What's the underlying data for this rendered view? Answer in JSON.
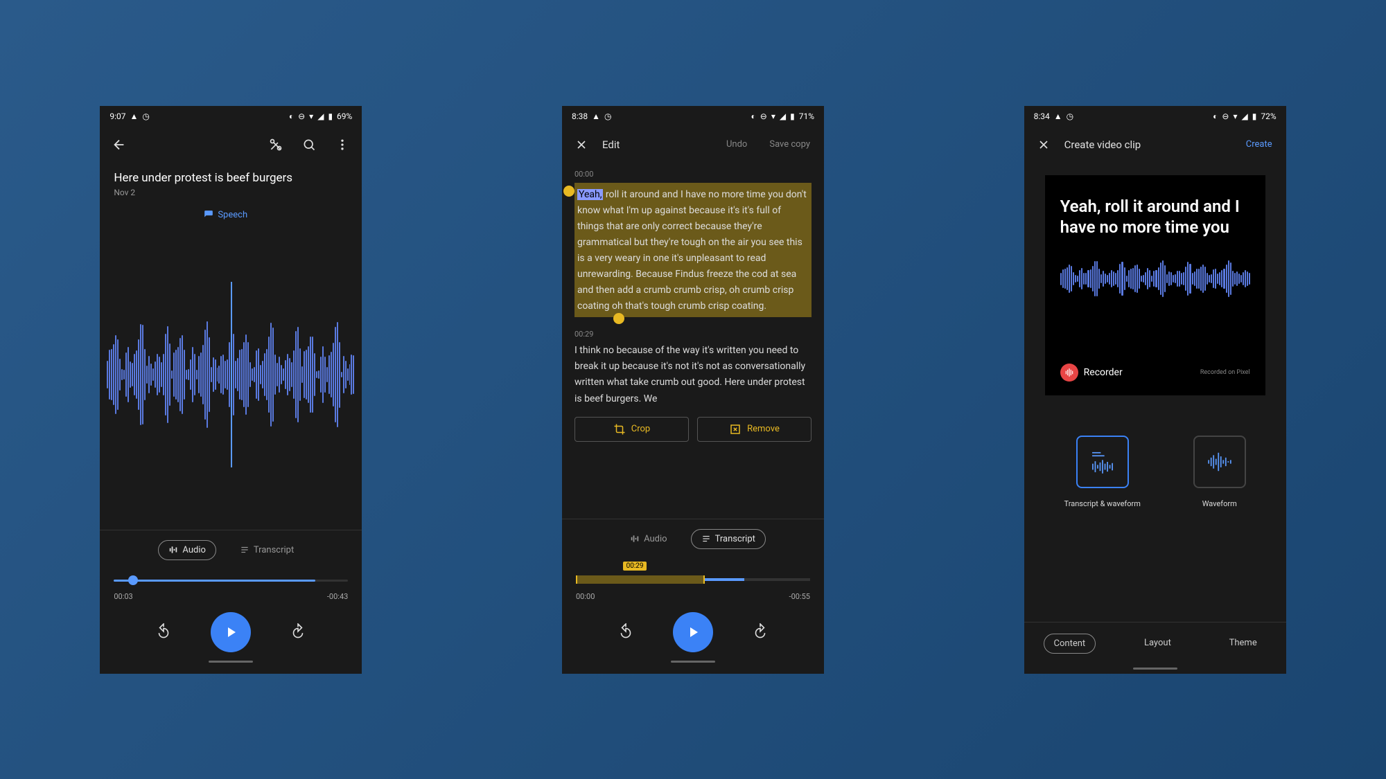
{
  "screen1": {
    "status": {
      "time": "9:07",
      "battery": "69%"
    },
    "title": "Here under protest is beef burgers",
    "date": "Nov 2",
    "speech_label": "Speech",
    "tabs": {
      "audio": "Audio",
      "transcript": "Transcript"
    },
    "time_current": "00:03",
    "time_remaining": "-00:43",
    "progress_percent": 7
  },
  "screen2": {
    "status": {
      "time": "8:38",
      "battery": "71%"
    },
    "title": "Edit",
    "undo": "Undo",
    "save": "Save copy",
    "ts1_time": "00:00",
    "ts1_word": "Yeah,",
    "ts1_text": " roll it around and I have no more time you don't know what I'm up against because it's it's full of things that are only correct because they're grammatical but they're tough on the air you see this is a very weary in one it's unpleasant to read unrewarding. Because Findus freeze the cod at sea and then add a crumb crumb crisp, oh crumb crisp coating oh that's tough crumb crisp coating.",
    "ts2_time": "00:29",
    "ts2_text": "I think no because of the way it's written you need to break it up because it's not it's not as conversationally written what take crumb out good. Here under protest is beef burgers. We",
    "crop": "Crop",
    "remove": "Remove",
    "tabs": {
      "audio": "Audio",
      "transcript": "Transcript"
    },
    "sel_time": "00:29",
    "time_current": "00:00",
    "time_remaining": "-00:55"
  },
  "screen3": {
    "status": {
      "time": "8:34",
      "battery": "72%"
    },
    "title": "Create video clip",
    "create": "Create",
    "clip_text": "Yeah, roll it around and I have no more time you",
    "recorder": "Recorder",
    "footnote": "Recorded on Pixel",
    "opt1": "Transcript & waveform",
    "opt2": "Waveform",
    "tabs": {
      "content": "Content",
      "layout": "Layout",
      "theme": "Theme"
    }
  }
}
